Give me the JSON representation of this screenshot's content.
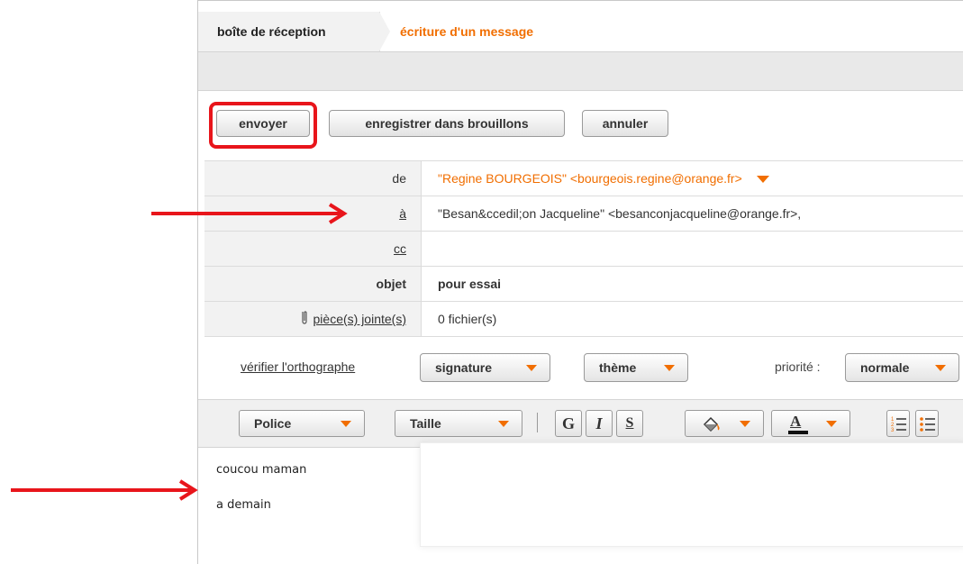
{
  "tabs": {
    "inbox": "boîte de réception",
    "compose": "écriture d'un message"
  },
  "actions": {
    "send": "envoyer",
    "save_draft": "enregistrer dans brouillons",
    "cancel": "annuler"
  },
  "fields": {
    "from_label": "de",
    "from_value": "\"Regine BOURGEOIS\" <bourgeois.regine@orange.fr>",
    "to_label": "à",
    "to_value": "\"Besan&ccedil;on Jacqueline\" <besanconjacqueline@orange.fr>,",
    "cc_label": "cc",
    "cc_value": "",
    "subject_label": "objet",
    "subject_value": "pour essai",
    "attachments_label": "pièce(s) jointe(s)",
    "attachments_value": "0 fichier(s)"
  },
  "options": {
    "spellcheck": "vérifier l'orthographe",
    "signature": "signature",
    "theme": "thème",
    "priority_label": "priorité :",
    "priority_value": "normale"
  },
  "toolbar": {
    "font": "Police",
    "size": "Taille",
    "bold": "G",
    "italic": "I",
    "strike": "S",
    "font_color": "A"
  },
  "body": {
    "line1": "coucou maman",
    "line2": "a demain"
  },
  "icons": {
    "dropdown": "triangle-down-icon",
    "paperclip": "paperclip-icon",
    "fill": "paint-bucket-icon",
    "ordered_list": "ordered-list-icon",
    "bullet_list": "bullet-list-icon"
  },
  "colors": {
    "accent": "#f16e00",
    "annotation": "#e8151b"
  }
}
